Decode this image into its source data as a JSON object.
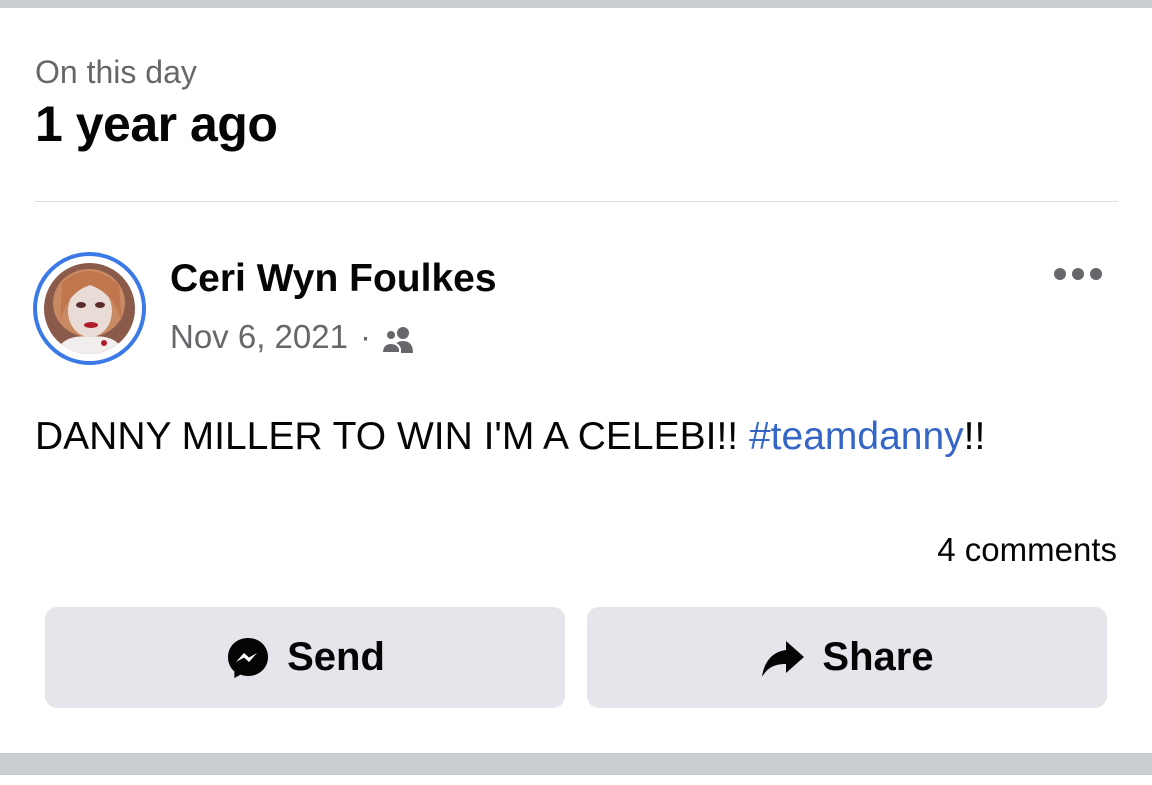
{
  "memory": {
    "label": "On this day",
    "title": "1 year ago"
  },
  "post": {
    "author": "Ceri Wyn Foulkes",
    "date": "Nov 6, 2021",
    "separator": "·",
    "audience_icon": "friends-icon",
    "text_main": "DANNY MILLER TO WIN I'M A CELEBI!! ",
    "hashtag": "#teamdanny",
    "text_tail": "!!",
    "comments": "4 comments",
    "more_icon": "more-horizontal-icon"
  },
  "actions": {
    "send_label": "Send",
    "send_icon": "messenger-icon",
    "share_label": "Share",
    "share_icon": "share-arrow-icon"
  },
  "colors": {
    "avatar_ring": "#3b7ae6",
    "hashtag": "#3566c7",
    "button_bg": "#e4e6eb",
    "secondary_text": "#65676b"
  }
}
